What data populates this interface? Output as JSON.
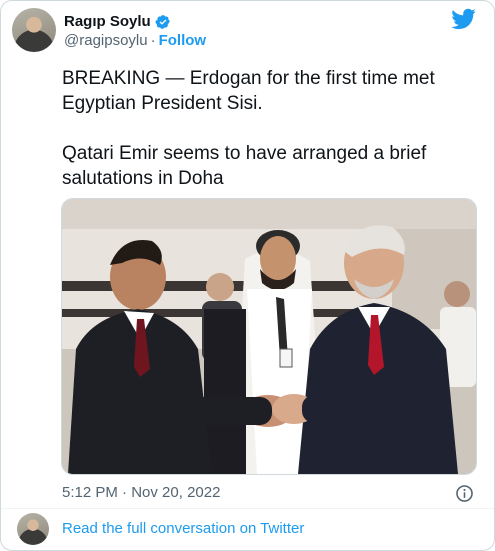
{
  "author": {
    "name": "Ragıp Soylu",
    "handle": "@ragipsoylu",
    "separator": "·",
    "follow_label": "Follow"
  },
  "tweet": {
    "text": "BREAKING — Erdogan for the first time  met Egyptian President Sisi.\n\nQatari Emir seems to have arranged a brief salutations in Doha",
    "time": "5:12 PM",
    "separator": "·",
    "date": "Nov 20, 2022"
  },
  "footer": {
    "read_label": "Read the full conversation on Twitter"
  },
  "icons": {
    "brand": "twitter-bird-icon",
    "verified": "verified-badge-icon",
    "info": "info-icon"
  },
  "colors": {
    "accent": "#1d9bf0",
    "text": "#0f1419",
    "muted": "#536471",
    "border": "#cfd9de"
  }
}
